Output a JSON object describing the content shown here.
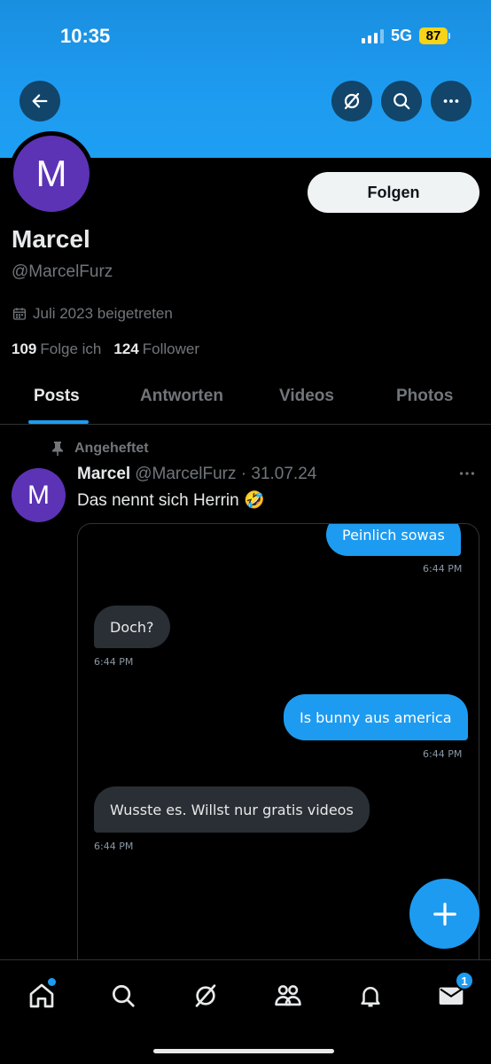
{
  "status_bar": {
    "time": "10:35",
    "network": "5G",
    "battery": "87"
  },
  "header": {
    "back_icon": "arrow-left-icon",
    "grok_icon": "grok-icon",
    "search_icon": "search-icon",
    "more_icon": "more-horizontal-icon",
    "banner_color": "#1d9bf0"
  },
  "profile": {
    "avatar_letter": "M",
    "avatar_color": "#5c33b5",
    "follow_label": "Folgen",
    "display_name": "Marcel",
    "handle": "@MarcelFurz",
    "joined": "Juli 2023 beigetreten",
    "following_count": "109",
    "following_label": "Folge ich",
    "followers_count": "124",
    "followers_label": "Follower"
  },
  "tabs": [
    {
      "label": "Posts",
      "active": true
    },
    {
      "label": "Antworten",
      "active": false
    },
    {
      "label": "Videos",
      "active": false
    },
    {
      "label": "Photos",
      "active": false
    }
  ],
  "post": {
    "pinned_label": "Angeheftet",
    "avatar_letter": "M",
    "author": "Marcel",
    "meta": "@MarcelFurz · 31.07.24",
    "text": "Das nennt sich Herrin 🤣",
    "more_icon": "more-horizontal-icon",
    "media": {
      "messages": [
        {
          "text": "Peinlich sowas",
          "time": "6:44 PM",
          "direction": "out"
        },
        {
          "text": "Doch?",
          "time": "6:44 PM",
          "direction": "in"
        },
        {
          "text": "Is bunny aus america",
          "time": "6:44 PM",
          "direction": "out"
        },
        {
          "text": "Wusste es. Willst nur gratis videos",
          "time": "6:44 PM",
          "direction": "in"
        }
      ]
    }
  },
  "fab": {
    "icon": "plus-icon"
  },
  "bottom_nav": {
    "items": [
      "home-icon",
      "search-icon",
      "grok-icon",
      "communities-icon",
      "notifications-icon",
      "messages-icon"
    ],
    "messages_badge": "1"
  },
  "colors": {
    "accent": "#1d9bf0",
    "background": "#000000",
    "muted": "#71767b"
  }
}
